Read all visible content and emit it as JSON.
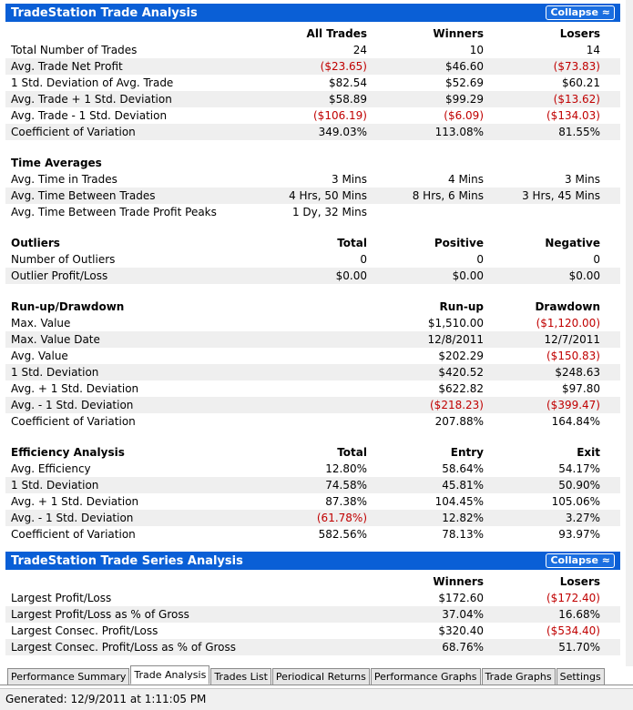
{
  "trade_analysis": {
    "title": "TradeStation Trade Analysis",
    "collapse_label": "Collapse ≈",
    "sections": {
      "summary": {
        "headers": [
          "",
          "All Trades",
          "Winners",
          "Losers"
        ],
        "rows": [
          {
            "label": "Total Number of Trades",
            "v": [
              "24",
              "10",
              "14"
            ]
          },
          {
            "label": "Avg. Trade Net Profit",
            "v": [
              "($23.65)",
              "$46.60",
              "($73.83)"
            ]
          },
          {
            "label": "1 Std. Deviation of Avg. Trade",
            "v": [
              "$82.54",
              "$52.69",
              "$60.21"
            ]
          },
          {
            "label": "Avg. Trade + 1 Std. Deviation",
            "v": [
              "$58.89",
              "$99.29",
              "($13.62)"
            ]
          },
          {
            "label": "Avg. Trade - 1 Std. Deviation",
            "v": [
              "($106.19)",
              "($6.09)",
              "($134.03)"
            ]
          },
          {
            "label": "Coefficient of Variation",
            "v": [
              "349.03%",
              "113.08%",
              "81.55%"
            ]
          }
        ]
      },
      "time_averages": {
        "headers": [
          "Time Averages",
          "",
          "",
          ""
        ],
        "rows": [
          {
            "label": "Avg. Time in Trades",
            "v": [
              "3 Mins",
              "4 Mins",
              "3 Mins"
            ]
          },
          {
            "label": "Avg. Time Between Trades",
            "v": [
              "4 Hrs, 50 Mins",
              "8 Hrs, 6 Mins",
              "3 Hrs, 45 Mins"
            ]
          },
          {
            "label": "Avg. Time Between Trade Profit Peaks",
            "v": [
              "1 Dy, 32 Mins",
              "",
              ""
            ]
          }
        ]
      },
      "outliers": {
        "headers": [
          "Outliers",
          "Total",
          "Positive",
          "Negative"
        ],
        "rows": [
          {
            "label": "Number of Outliers",
            "v": [
              "0",
              "0",
              "0"
            ]
          },
          {
            "label": "Outlier Profit/Loss",
            "v": [
              "$0.00",
              "$0.00",
              "$0.00"
            ]
          }
        ]
      },
      "runup_drawdown": {
        "headers": [
          "Run-up/Drawdown",
          "",
          "Run-up",
          "Drawdown"
        ],
        "rows": [
          {
            "label": "Max. Value",
            "v": [
              "",
              "$1,510.00",
              "($1,120.00)"
            ]
          },
          {
            "label": "Max. Value Date",
            "v": [
              "",
              "12/8/2011",
              "12/7/2011"
            ]
          },
          {
            "label": "Avg. Value",
            "v": [
              "",
              "$202.29",
              "($150.83)"
            ]
          },
          {
            "label": "1 Std. Deviation",
            "v": [
              "",
              "$420.52",
              "$248.63"
            ]
          },
          {
            "label": "Avg. + 1 Std. Deviation",
            "v": [
              "",
              "$622.82",
              "$97.80"
            ]
          },
          {
            "label": "Avg. - 1 Std. Deviation",
            "v": [
              "",
              "($218.23)",
              "($399.47)"
            ]
          },
          {
            "label": "Coefficient of Variation",
            "v": [
              "",
              "207.88%",
              "164.84%"
            ]
          }
        ]
      },
      "efficiency": {
        "headers": [
          "Efficiency Analysis",
          "Total",
          "Entry",
          "Exit"
        ],
        "rows": [
          {
            "label": "Avg. Efficiency",
            "v": [
              "12.80%",
              "58.64%",
              "54.17%"
            ]
          },
          {
            "label": "1 Std. Deviation",
            "v": [
              "74.58%",
              "45.81%",
              "50.90%"
            ]
          },
          {
            "label": "Avg. + 1 Std. Deviation",
            "v": [
              "87.38%",
              "104.45%",
              "105.06%"
            ]
          },
          {
            "label": "Avg. - 1 Std. Deviation",
            "v": [
              "(61.78%)",
              "12.82%",
              "3.27%"
            ]
          },
          {
            "label": "Coefficient of Variation",
            "v": [
              "582.56%",
              "78.13%",
              "93.97%"
            ]
          }
        ]
      }
    }
  },
  "trade_series": {
    "title": "TradeStation Trade Series Analysis",
    "collapse_label": "Collapse ≈",
    "headers": [
      "",
      "",
      "Winners",
      "Losers"
    ],
    "rows": [
      {
        "label": "Largest Profit/Loss",
        "v": [
          "",
          "$172.60",
          "($172.40)"
        ]
      },
      {
        "label": "Largest Profit/Loss as % of Gross",
        "v": [
          "",
          "37.04%",
          "16.68%"
        ]
      },
      {
        "label": "Largest Consec. Profit/Loss",
        "v": [
          "",
          "$320.40",
          "($534.40)"
        ]
      },
      {
        "label": "Largest Consec. Profit/Loss as % of Gross",
        "v": [
          "",
          "68.76%",
          "51.70%"
        ]
      }
    ]
  },
  "tabs": [
    "Performance Summary",
    "Trade Analysis",
    "Trades List",
    "Periodical Returns",
    "Performance Graphs",
    "Trade Graphs",
    "Settings"
  ],
  "active_tab": "Trade Analysis",
  "status": "Generated: 12/9/2011 at 1:11:05 PM",
  "colors": {
    "header_blue": "#0a5fd6",
    "negative_red": "#c00000",
    "alt_row": "#efefef"
  }
}
